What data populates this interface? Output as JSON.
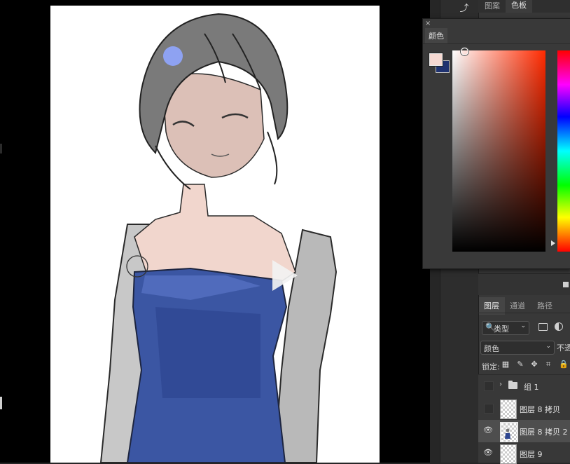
{
  "dock": {
    "tabs": [
      {
        "label": "图案",
        "active": false
      },
      {
        "label": "色板",
        "active": true
      }
    ]
  },
  "color_panel": {
    "close_glyph": "×",
    "tab_label": "颜色",
    "foreground_color": "#f6d9d2",
    "background_color": "#1f3270",
    "hue_color": "#ff2a00"
  },
  "layers_panel": {
    "tabs": [
      {
        "label": "图层",
        "active": true
      },
      {
        "label": "通道",
        "active": false
      },
      {
        "label": "路径",
        "active": false
      }
    ],
    "filter": {
      "label": "类型",
      "search_glyph": "🔍",
      "chevron": "⌄"
    },
    "blend_mode": {
      "label": "颜色",
      "chevron": "⌄"
    },
    "opacity_label": "不透明度",
    "lock_label": "锁定:",
    "rows": [
      {
        "type": "group",
        "name": "组 1",
        "visible": false,
        "selected": false
      },
      {
        "type": "layer",
        "name": "图层 8 拷贝",
        "visible": false,
        "selected": false
      },
      {
        "type": "layer",
        "name": "图层 8 拷贝 2",
        "visible": true,
        "selected": true
      },
      {
        "type": "layer",
        "name": "图层 9",
        "visible": true,
        "selected": false
      }
    ]
  },
  "icons": {
    "history": "history-brush-icon",
    "eye": "eye-icon",
    "lock_transparent": "checker-lock-icon",
    "lock_paint": "brush-lock-icon",
    "lock_move": "move-lock-icon",
    "lock_artboard": "artboard-lock-icon",
    "lock_all": "padlock-icon"
  }
}
